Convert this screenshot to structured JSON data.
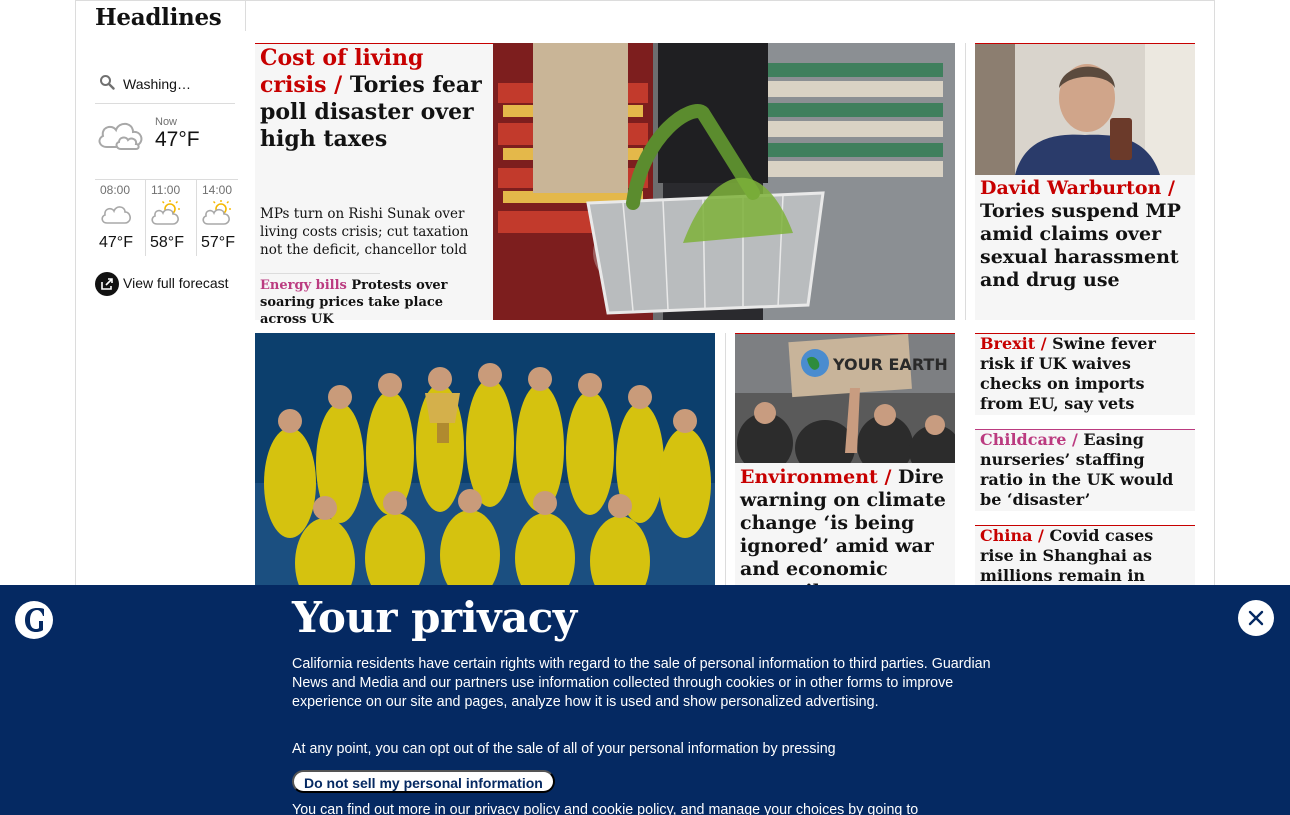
{
  "section": {
    "title": "Headlines"
  },
  "weather": {
    "location": "Washing…",
    "now": {
      "label": "Now",
      "temp": "47°F",
      "icon": "cloud-icon"
    },
    "forecast": [
      {
        "time": "08:00",
        "temp": "47°F",
        "icon": "cloud-icon"
      },
      {
        "time": "11:00",
        "temp": "58°F",
        "icon": "sun-cloud-icon"
      },
      {
        "time": "14:00",
        "temp": "57°F",
        "icon": "sun-cloud-icon"
      }
    ],
    "link": "View full forecast"
  },
  "main_story": {
    "kicker": "Cost of living crisis",
    "separator": " /",
    "headline": "Tories fear poll disaster over high taxes",
    "standfirst": "MPs turn on Rishi Sunak over living costs crisis; cut taxation not the deficit, chancellor told",
    "sublink_kicker": "Energy bills",
    "sublink": "Protests over soaring prices take place across UK"
  },
  "mp_story": {
    "kicker": "David Warburton /",
    "headline": "Tories suspend MP amid claims over sexual harassment and drug use"
  },
  "small_stories": [
    {
      "kicker": "Brexit /",
      "headline": "Swine fever risk if UK waives checks on imports from EU, say vets",
      "color": "#c70000"
    },
    {
      "kicker": "Childcare /",
      "headline": "Easing nurseries’ staffing ratio in the UK would be ‘disaster’",
      "color": "#bb3b80"
    },
    {
      "kicker": "China /",
      "headline": "Covid cases rise in Shanghai as millions remain in lockdown",
      "color": "#c70000"
    }
  ],
  "env_story": {
    "kicker": "Environment /",
    "headline": "Dire warning on climate change ‘is being ignored’ amid war and economic turmoil",
    "placard": "YOUR EARTH"
  },
  "privacy": {
    "title": "Your privacy",
    "paragraph1": "California residents have certain rights with regard to the sale of personal information to third parties. Guardian News and Media and our partners use information collected through cookies or in other forms to improve experience on our site and pages, analyze how it is used and show personalized advertising.",
    "paragraph2": "At any point, you can opt out of the sale of all of your personal information by pressing",
    "button": "Do not sell my personal information",
    "paragraph3": "You can find out more in our privacy policy and cookie policy, and manage your choices by going to",
    "close_icon": "close-icon",
    "logo": "guardian-logo"
  },
  "colors": {
    "news_red": "#c70000",
    "lifestyle_pink": "#bb3b80",
    "privacy_bg": "#052962"
  }
}
